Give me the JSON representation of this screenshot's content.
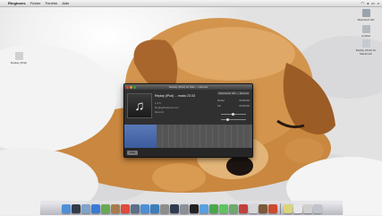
{
  "menubar": {
    "app_name": "Ringtones",
    "items": [
      "Fichier",
      "Fenêtre",
      "Aide"
    ]
  },
  "desktop_icons": [
    {
      "label": "Macintosh HD",
      "icon": "hard-drive-icon",
      "color": "#9aa3ad"
    },
    {
      "label": "Untitled",
      "icon": "disk-icon",
      "color": "#b4b9c0"
    },
    {
      "label": "Replay (iPod) for Macintosh",
      "icon": "document-icon",
      "color": "#c5cad2"
    },
    {
      "label": "Replay (iPod)",
      "icon": "file-icon",
      "color": "#d0d0d0"
    }
  ],
  "replay_window": {
    "title": "Replay (iPod) for Mac — Record",
    "song_title": "Replay (iPod) ... music 23.03",
    "artwork_icon": "music-note-icon",
    "artwork_glyph": "♫",
    "meta": [
      "1.2.5",
      "ReplayPodmac.com",
      "Record"
    ],
    "info_head": "Macintosh HD — Record",
    "info_rows": [
      {
        "label": "Début",
        "value": "00:00:00"
      },
      {
        "label": "Fin",
        "value": "00:00:00"
      },
      {
        "label": "Durée",
        "value": "00:00"
      }
    ],
    "stop_label": "Stop",
    "progress": 0.25
  },
  "dock": {
    "apps": [
      {
        "name": "finder-icon",
        "color": "#4f8fd6"
      },
      {
        "name": "dashboard-icon",
        "color": "#333c4a"
      },
      {
        "name": "mail-icon",
        "color": "#7fa3c9"
      },
      {
        "name": "safari-icon",
        "color": "#3a7bd5"
      },
      {
        "name": "ichat-icon",
        "color": "#6aa94f"
      },
      {
        "name": "address-book-icon",
        "color": "#a77b4d"
      },
      {
        "name": "ical-icon",
        "color": "#e04a3a"
      },
      {
        "name": "preview-icon",
        "color": "#5d6f86"
      },
      {
        "name": "itunes-icon",
        "color": "#4e8ed3"
      },
      {
        "name": "iphoto-icon",
        "color": "#3b7eb8"
      },
      {
        "name": "imovie-icon",
        "color": "#8d8d8d"
      },
      {
        "name": "time-machine-icon",
        "color": "#2f3d52"
      },
      {
        "name": "system-preferences-icon",
        "color": "#8a8f96"
      },
      {
        "name": "terminal-icon",
        "color": "#222"
      },
      {
        "name": "app-store-icon",
        "color": "#5aa0e0"
      },
      {
        "name": "facetime-icon",
        "color": "#4aa84a"
      },
      {
        "name": "messages-icon",
        "color": "#5fc35f"
      },
      {
        "name": "maps-icon",
        "color": "#6ea86e"
      },
      {
        "name": "photo-booth-icon",
        "color": "#c2413a"
      },
      {
        "name": "replay-icon",
        "color": "#d6d6d6"
      },
      {
        "name": "chess-icon",
        "color": "#7a5a3a"
      },
      {
        "name": "font-book-icon",
        "color": "#cc4b2c"
      }
    ],
    "right_items": [
      {
        "name": "applications-stack-icon",
        "color": "#dad47a"
      },
      {
        "name": "documents-stack-icon",
        "color": "#e6e6e6"
      },
      {
        "name": "downloads-stack-icon",
        "color": "#cfcfcf"
      },
      {
        "name": "trash-icon",
        "color": "#bfc4ca"
      }
    ]
  }
}
